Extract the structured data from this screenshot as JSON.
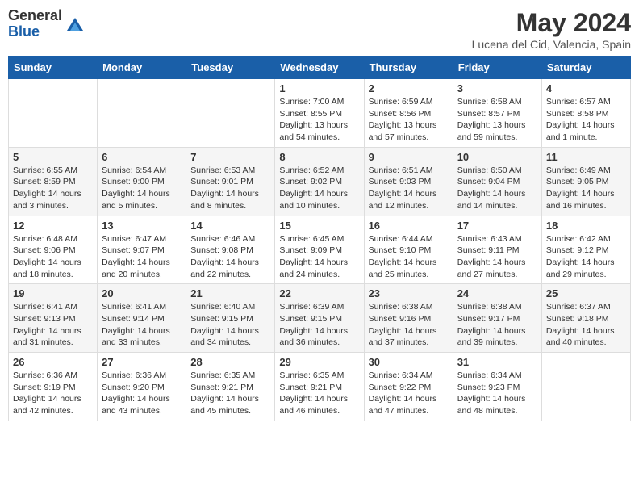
{
  "header": {
    "logo_general": "General",
    "logo_blue": "Blue",
    "month_title": "May 2024",
    "location": "Lucena del Cid, Valencia, Spain"
  },
  "weekdays": [
    "Sunday",
    "Monday",
    "Tuesday",
    "Wednesday",
    "Thursday",
    "Friday",
    "Saturday"
  ],
  "weeks": [
    [
      {
        "day": "",
        "info": ""
      },
      {
        "day": "",
        "info": ""
      },
      {
        "day": "",
        "info": ""
      },
      {
        "day": "1",
        "info": "Sunrise: 7:00 AM\nSunset: 8:55 PM\nDaylight: 13 hours\nand 54 minutes."
      },
      {
        "day": "2",
        "info": "Sunrise: 6:59 AM\nSunset: 8:56 PM\nDaylight: 13 hours\nand 57 minutes."
      },
      {
        "day": "3",
        "info": "Sunrise: 6:58 AM\nSunset: 8:57 PM\nDaylight: 13 hours\nand 59 minutes."
      },
      {
        "day": "4",
        "info": "Sunrise: 6:57 AM\nSunset: 8:58 PM\nDaylight: 14 hours\nand 1 minute."
      }
    ],
    [
      {
        "day": "5",
        "info": "Sunrise: 6:55 AM\nSunset: 8:59 PM\nDaylight: 14 hours\nand 3 minutes."
      },
      {
        "day": "6",
        "info": "Sunrise: 6:54 AM\nSunset: 9:00 PM\nDaylight: 14 hours\nand 5 minutes."
      },
      {
        "day": "7",
        "info": "Sunrise: 6:53 AM\nSunset: 9:01 PM\nDaylight: 14 hours\nand 8 minutes."
      },
      {
        "day": "8",
        "info": "Sunrise: 6:52 AM\nSunset: 9:02 PM\nDaylight: 14 hours\nand 10 minutes."
      },
      {
        "day": "9",
        "info": "Sunrise: 6:51 AM\nSunset: 9:03 PM\nDaylight: 14 hours\nand 12 minutes."
      },
      {
        "day": "10",
        "info": "Sunrise: 6:50 AM\nSunset: 9:04 PM\nDaylight: 14 hours\nand 14 minutes."
      },
      {
        "day": "11",
        "info": "Sunrise: 6:49 AM\nSunset: 9:05 PM\nDaylight: 14 hours\nand 16 minutes."
      }
    ],
    [
      {
        "day": "12",
        "info": "Sunrise: 6:48 AM\nSunset: 9:06 PM\nDaylight: 14 hours\nand 18 minutes."
      },
      {
        "day": "13",
        "info": "Sunrise: 6:47 AM\nSunset: 9:07 PM\nDaylight: 14 hours\nand 20 minutes."
      },
      {
        "day": "14",
        "info": "Sunrise: 6:46 AM\nSunset: 9:08 PM\nDaylight: 14 hours\nand 22 minutes."
      },
      {
        "day": "15",
        "info": "Sunrise: 6:45 AM\nSunset: 9:09 PM\nDaylight: 14 hours\nand 24 minutes."
      },
      {
        "day": "16",
        "info": "Sunrise: 6:44 AM\nSunset: 9:10 PM\nDaylight: 14 hours\nand 25 minutes."
      },
      {
        "day": "17",
        "info": "Sunrise: 6:43 AM\nSunset: 9:11 PM\nDaylight: 14 hours\nand 27 minutes."
      },
      {
        "day": "18",
        "info": "Sunrise: 6:42 AM\nSunset: 9:12 PM\nDaylight: 14 hours\nand 29 minutes."
      }
    ],
    [
      {
        "day": "19",
        "info": "Sunrise: 6:41 AM\nSunset: 9:13 PM\nDaylight: 14 hours\nand 31 minutes."
      },
      {
        "day": "20",
        "info": "Sunrise: 6:41 AM\nSunset: 9:14 PM\nDaylight: 14 hours\nand 33 minutes."
      },
      {
        "day": "21",
        "info": "Sunrise: 6:40 AM\nSunset: 9:15 PM\nDaylight: 14 hours\nand 34 minutes."
      },
      {
        "day": "22",
        "info": "Sunrise: 6:39 AM\nSunset: 9:15 PM\nDaylight: 14 hours\nand 36 minutes."
      },
      {
        "day": "23",
        "info": "Sunrise: 6:38 AM\nSunset: 9:16 PM\nDaylight: 14 hours\nand 37 minutes."
      },
      {
        "day": "24",
        "info": "Sunrise: 6:38 AM\nSunset: 9:17 PM\nDaylight: 14 hours\nand 39 minutes."
      },
      {
        "day": "25",
        "info": "Sunrise: 6:37 AM\nSunset: 9:18 PM\nDaylight: 14 hours\nand 40 minutes."
      }
    ],
    [
      {
        "day": "26",
        "info": "Sunrise: 6:36 AM\nSunset: 9:19 PM\nDaylight: 14 hours\nand 42 minutes."
      },
      {
        "day": "27",
        "info": "Sunrise: 6:36 AM\nSunset: 9:20 PM\nDaylight: 14 hours\nand 43 minutes."
      },
      {
        "day": "28",
        "info": "Sunrise: 6:35 AM\nSunset: 9:21 PM\nDaylight: 14 hours\nand 45 minutes."
      },
      {
        "day": "29",
        "info": "Sunrise: 6:35 AM\nSunset: 9:21 PM\nDaylight: 14 hours\nand 46 minutes."
      },
      {
        "day": "30",
        "info": "Sunrise: 6:34 AM\nSunset: 9:22 PM\nDaylight: 14 hours\nand 47 minutes."
      },
      {
        "day": "31",
        "info": "Sunrise: 6:34 AM\nSunset: 9:23 PM\nDaylight: 14 hours\nand 48 minutes."
      },
      {
        "day": "",
        "info": ""
      }
    ]
  ]
}
